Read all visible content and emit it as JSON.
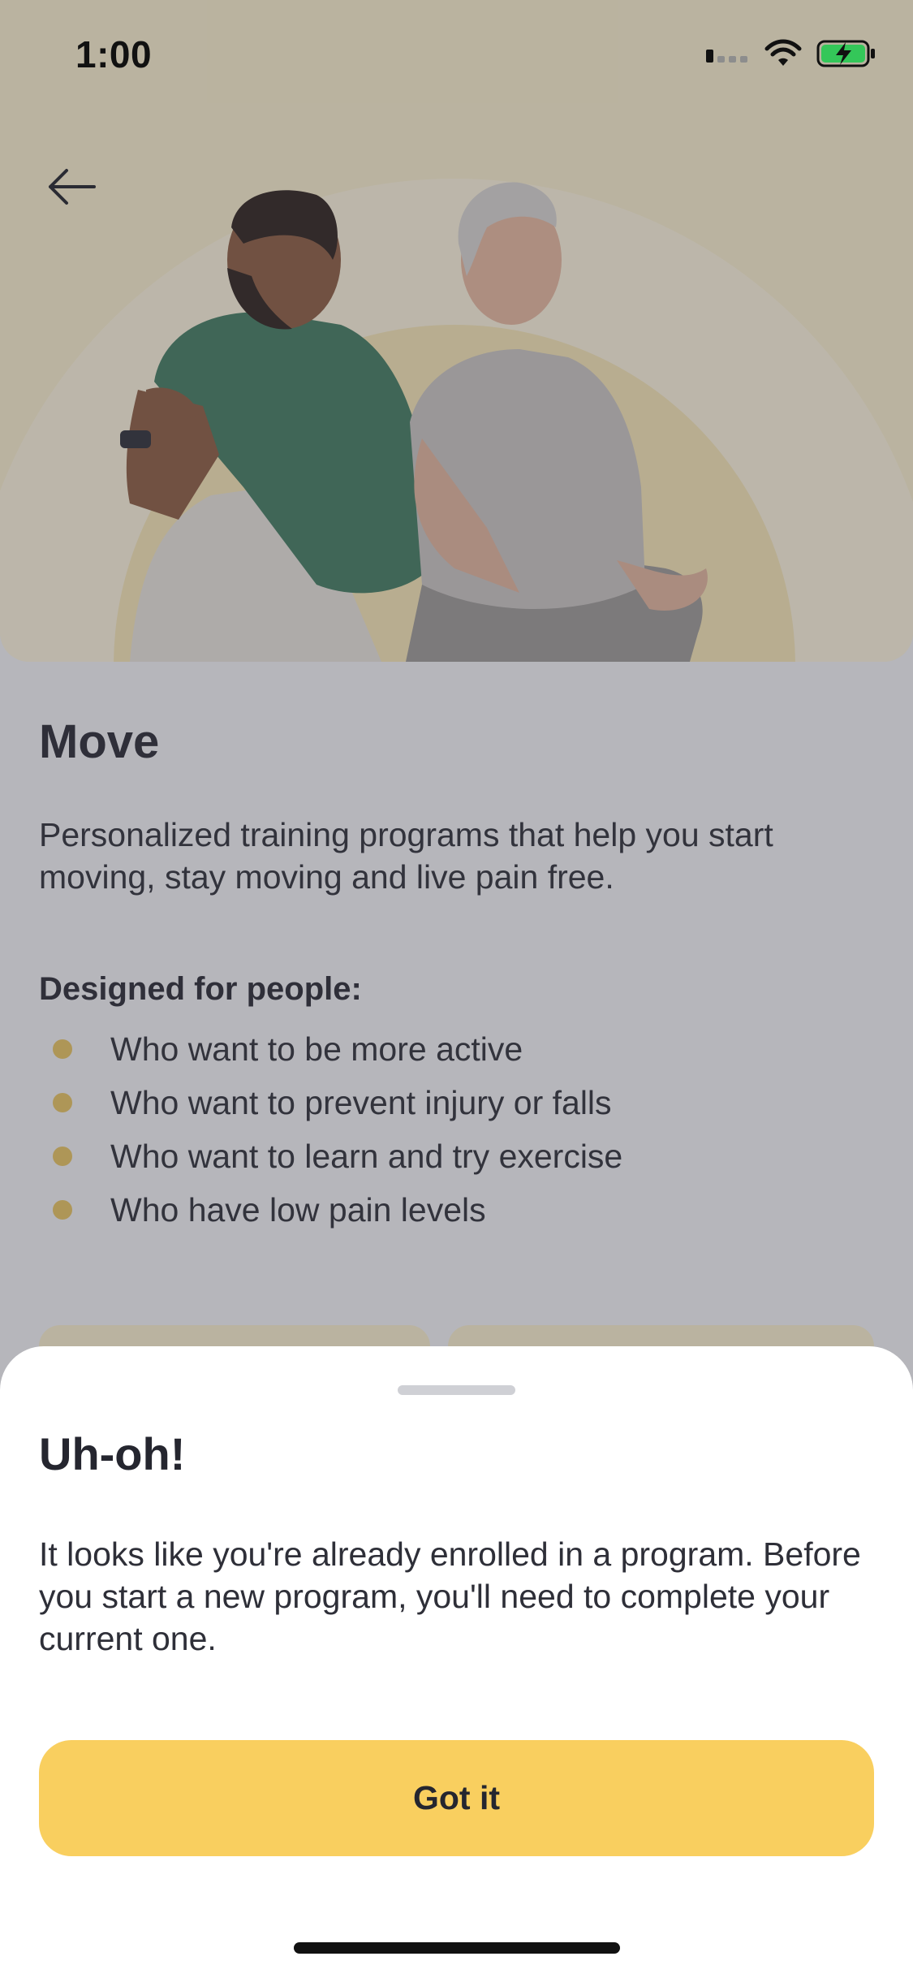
{
  "status_bar": {
    "time": "1:00",
    "signal_icon": "cellular-signal-icon",
    "wifi_icon": "wifi-icon",
    "battery_icon": "battery-charging-icon"
  },
  "hero": {
    "image_description_icon": "hero-illustration",
    "back_icon": "arrow-left-icon"
  },
  "program": {
    "title": "Move",
    "description": "Personalized training programs that help you start moving, stay moving and live pain free.",
    "audience_heading": "Designed for people:",
    "audience": [
      "Who want to be more active",
      "Who want to prevent injury or falls",
      "Who want to learn and try exercise",
      "Who have low pain levels"
    ]
  },
  "sheet": {
    "title": "Uh-oh!",
    "message": "It looks like you're already enrolled in a program. Before you start a new program, you'll need to complete your current one.",
    "button_label": "Got it"
  },
  "colors": {
    "accent": "#f9cf5f",
    "hero_background": "#fbf0cc",
    "bullet": "#e8c35d",
    "text": "#25262f"
  }
}
